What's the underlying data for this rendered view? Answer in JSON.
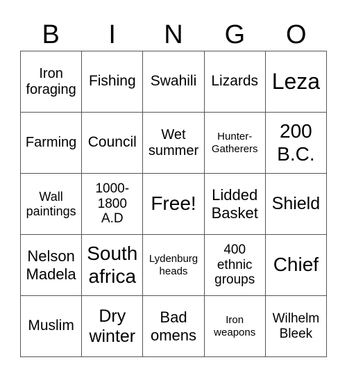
{
  "header": {
    "letters": [
      "B",
      "I",
      "N",
      "G",
      "O"
    ]
  },
  "grid": {
    "rows": [
      [
        "Iron\nforaging",
        "Fishing",
        "Swahili",
        "Lizards",
        "Leza"
      ],
      [
        "Farming",
        "Council",
        "Wet\nsummer",
        "Hunter-\nGatherers",
        "200\nB.C."
      ],
      [
        "Wall\npaintings",
        "1000-\n1800\nA.D",
        "Free!",
        "Lidded\nBasket",
        "Shield"
      ],
      [
        "Nelson\nMadela",
        "South\nafrica",
        "Lydenburg\nheads",
        "400\nethnic\ngroups",
        "Chief"
      ],
      [
        "Muslim",
        "Dry\nwinter",
        "Bad\nomens",
        "Iron\nweapons",
        "Wilhelm\nBleek"
      ]
    ]
  }
}
